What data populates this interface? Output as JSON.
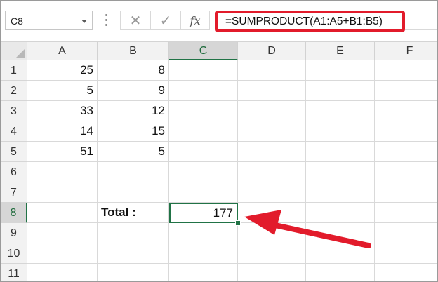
{
  "name_box": {
    "value": "C8"
  },
  "formula_bar": {
    "fx_label": "fx",
    "formula": "=SUMPRODUCT(A1:A5+B1:B5)",
    "icons": [
      "cancel-icon",
      "enter-icon",
      "insert-function-icon",
      "dropdown-arrow-icon"
    ]
  },
  "columns": [
    "A",
    "B",
    "C",
    "D",
    "E",
    "F"
  ],
  "selected_cell": "C8",
  "rows": [
    {
      "num": "1",
      "A": "25",
      "B": "8"
    },
    {
      "num": "2",
      "A": "5",
      "B": "9"
    },
    {
      "num": "3",
      "A": "33",
      "B": "12"
    },
    {
      "num": "4",
      "A": "14",
      "B": "15"
    },
    {
      "num": "5",
      "A": "51",
      "B": "5"
    },
    {
      "num": "6"
    },
    {
      "num": "7"
    },
    {
      "num": "8",
      "B": "Total :",
      "C": "177"
    },
    {
      "num": "9"
    },
    {
      "num": "10"
    },
    {
      "num": "11"
    }
  ],
  "colors": {
    "highlight": "#e21b2b",
    "selection": "#217346"
  }
}
